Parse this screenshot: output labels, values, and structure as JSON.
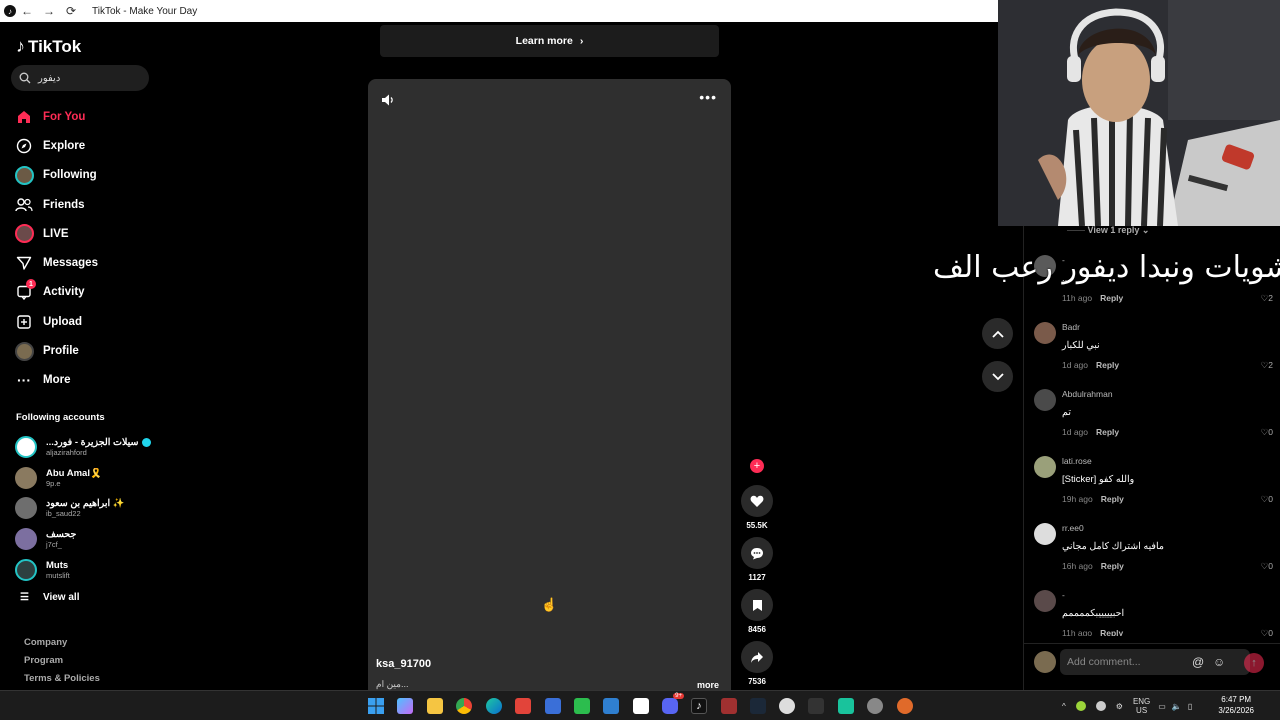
{
  "window": {
    "title": "TikTok - Make Your Day"
  },
  "sidebar": {
    "logo": "TikTok",
    "search_value": "ديفور",
    "nav": [
      {
        "label": "For You",
        "icon": "home-icon",
        "active": true
      },
      {
        "label": "Explore",
        "icon": "compass-icon"
      },
      {
        "label": "Following",
        "icon": "following-avatar-icon"
      },
      {
        "label": "Friends",
        "icon": "friends-icon"
      },
      {
        "label": "LIVE",
        "icon": "live-icon"
      },
      {
        "label": "Messages",
        "icon": "messages-icon"
      },
      {
        "label": "Activity",
        "icon": "activity-icon",
        "badge": "1"
      },
      {
        "label": "Upload",
        "icon": "upload-icon"
      },
      {
        "label": "Profile",
        "icon": "profile-avatar-icon"
      },
      {
        "label": "More",
        "icon": "more-icon"
      }
    ],
    "following_accounts_title": "Following accounts",
    "following_accounts": [
      {
        "name": "...سيلات الجزيرة - فورد",
        "handle": "aljazirahford",
        "verified": true
      },
      {
        "name": "Abu Amal🎗️",
        "handle": "9p.e"
      },
      {
        "name": "ابراهيم بن سعود ✨",
        "handle": "ib_saud22"
      },
      {
        "name": "جحسف",
        "handle": "j7cf_"
      },
      {
        "name": "Muts",
        "handle": "mutslift"
      }
    ],
    "view_all": "View all",
    "footer": [
      "Company",
      "Program",
      "Terms & Policies"
    ]
  },
  "feed": {
    "learn_more": "Learn more",
    "author": "ksa_91700",
    "description": "مين ام...",
    "more": "more",
    "actions": {
      "likes": "55.5K",
      "comments": "1127",
      "saves": "8456",
      "shares": "7536"
    }
  },
  "overlay_text": "شويات ونبدا ديفور رعب الف",
  "comments": {
    "view_reply": "View 1 reply",
    "items": [
      {
        "user": "-",
        "text": "...",
        "time": "11h ago",
        "reply": "Reply",
        "likes": "2"
      },
      {
        "user": "Badr",
        "text": "نبي للكبار",
        "time": "1d ago",
        "reply": "Reply",
        "likes": "2"
      },
      {
        "user": "Abdulrahman",
        "text": "تم",
        "time": "1d ago",
        "reply": "Reply",
        "likes": "0"
      },
      {
        "user": "lati.rose",
        "text": "[Sticker] والله كفو",
        "time": "19h ago",
        "reply": "Reply",
        "likes": "0"
      },
      {
        "user": "rr.ee0",
        "text": "مافيه اشتراك كامل مجاني",
        "time": "16h ago",
        "reply": "Reply",
        "likes": "0"
      },
      {
        "user": "-",
        "text": "احبيييييبكممممم",
        "time": "11h ago",
        "reply": "Reply",
        "likes": "0"
      }
    ],
    "add_placeholder": "Add comment..."
  },
  "taskbar": {
    "lang": "ENG",
    "region": "US",
    "time": "6:47 PM",
    "date": "3/26/2026",
    "discord_badge": "9+"
  },
  "colors": {
    "accent": "#fe2c55",
    "teal": "#20d5ec"
  }
}
